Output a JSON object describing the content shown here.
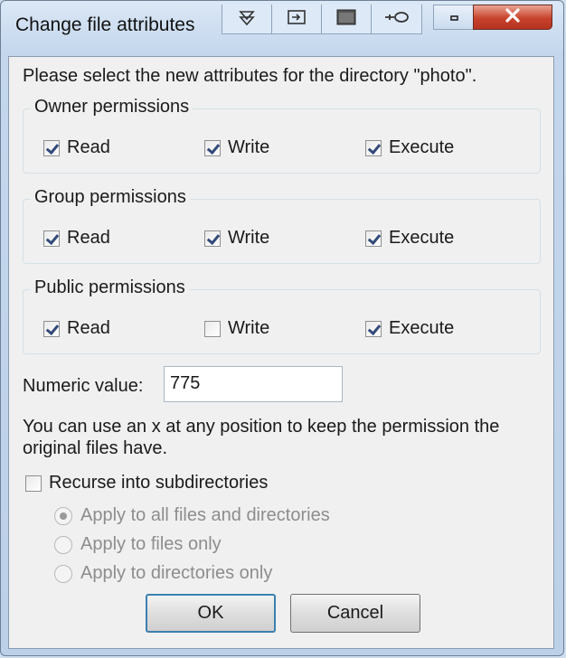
{
  "window": {
    "title": "Change file attributes"
  },
  "title_tools": [
    "down-triangle-icon",
    "window-icon",
    "window-filled-icon",
    "key-icon"
  ],
  "prompt": "Please select the new attributes for the directory \"photo\".",
  "groups": [
    {
      "title": "Owner permissions",
      "items": [
        {
          "label": "Read",
          "checked": true
        },
        {
          "label": "Write",
          "checked": true
        },
        {
          "label": "Execute",
          "checked": true
        }
      ]
    },
    {
      "title": "Group permissions",
      "items": [
        {
          "label": "Read",
          "checked": true
        },
        {
          "label": "Write",
          "checked": true
        },
        {
          "label": "Execute",
          "checked": true
        }
      ]
    },
    {
      "title": "Public permissions",
      "items": [
        {
          "label": "Read",
          "checked": true
        },
        {
          "label": "Write",
          "checked": false
        },
        {
          "label": "Execute",
          "checked": true
        }
      ]
    }
  ],
  "numeric": {
    "label": "Numeric value:",
    "value": "775"
  },
  "hint": {
    "line1": "You can use an x at any position to keep the permission the",
    "line2": "original files have."
  },
  "recurse": {
    "label": "Recurse into subdirectories",
    "checked": false
  },
  "apply_options": [
    {
      "label": "Apply to all files and directories",
      "selected": true
    },
    {
      "label": "Apply to files only",
      "selected": false
    },
    {
      "label": "Apply to directories only",
      "selected": false
    }
  ],
  "buttons": {
    "ok": "OK",
    "cancel": "Cancel"
  },
  "colors": {
    "close_button": "#c8432c",
    "ok_border": "#3c7fb1"
  }
}
